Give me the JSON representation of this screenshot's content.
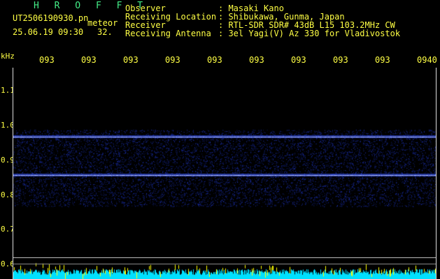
{
  "header": {
    "brand": "H R O F F T",
    "filename": "UT2506190930.pn",
    "tag": "meteor",
    "datetime": "25.06.19 09:30",
    "count": "32.",
    "info": [
      {
        "label": "Observer",
        "value": ": Masaki Kano"
      },
      {
        "label": "Receiving Location",
        "value": ": Shibukawa, Gunma, Japan"
      },
      {
        "label": "Receiver",
        "value": ": RTL-SDR SDR# 43dB L15 103.2MHz CW"
      },
      {
        "label": "Receiving Antenna",
        "value": ": 3el Yagi(V) Az 330 for Vladivostok"
      }
    ]
  },
  "axis": {
    "unit": "kHz",
    "y_ticks": [
      "1.1",
      "1.0",
      "0.9",
      "0.8",
      "0.7",
      "0.6"
    ],
    "x_ticks": [
      "093",
      "093",
      "093",
      "093",
      "093",
      "093",
      "093",
      "093",
      "093",
      "0940"
    ]
  },
  "spectrogram": {
    "freq_range_khz": [
      0.6,
      1.2
    ],
    "bands_khz": [
      0.98,
      0.87
    ],
    "noise_band_khz": [
      0.78,
      1.0
    ],
    "colors": {
      "background": "#000000",
      "noise": "#1e3cff",
      "line": "#e8ecff",
      "axis": "#ffff44",
      "baseline": "#00e0ff"
    }
  }
}
